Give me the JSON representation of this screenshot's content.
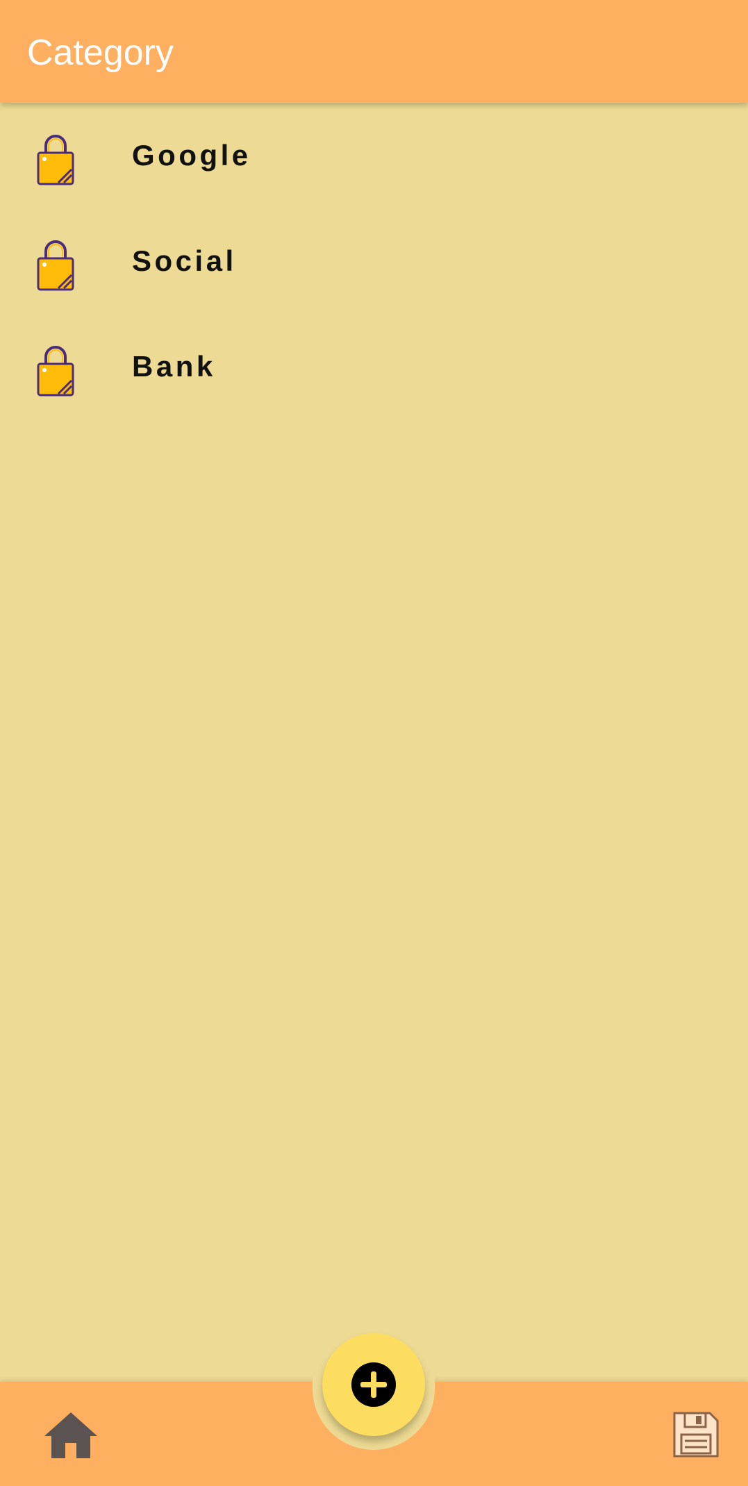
{
  "app_bar": {
    "title": "Category"
  },
  "categories": [
    {
      "label": "Google",
      "icon": "lock-icon"
    },
    {
      "label": "Social",
      "icon": "lock-icon"
    },
    {
      "label": "Bank",
      "icon": "lock-icon"
    }
  ],
  "bottom_nav": {
    "home_icon": "home-icon",
    "add_icon": "plus-circle-icon",
    "save_icon": "floppy-disk-icon"
  },
  "colors": {
    "app_bar": "#FEAF60",
    "background": "#EDDA94",
    "fab": "#FDDD60",
    "lock_body": "#FFBD0A",
    "lock_outline": "#4A2C7A",
    "text": "#111111"
  }
}
